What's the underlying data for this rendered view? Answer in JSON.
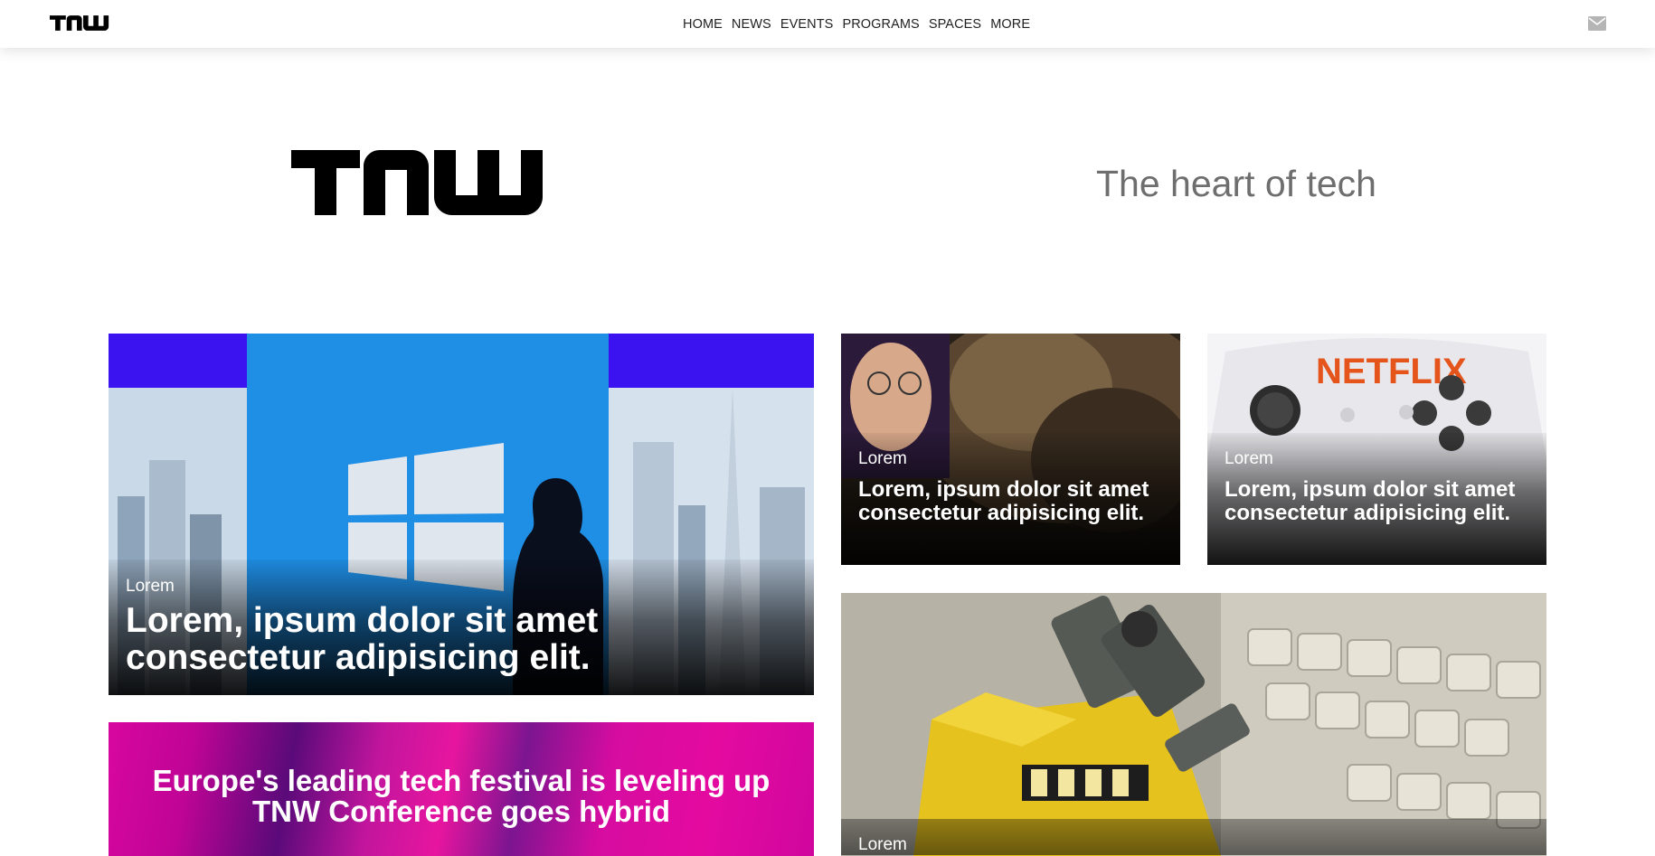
{
  "nav": {
    "logo_label": "TNW",
    "items": [
      "HOME",
      "NEWS",
      "EVENTS",
      "PROGRAMS",
      "SPACES",
      "MORE"
    ],
    "mail_icon": "envelope-icon"
  },
  "hero": {
    "logo_label": "TNW",
    "tagline": "The heart of tech"
  },
  "cards": [
    {
      "category": "Lorem",
      "title": "Lorem, ipsum dolor sit amet consectetur adipisicing elit.",
      "image": "windows-logo-keynote-photo"
    },
    {
      "category": "Lorem",
      "title": "Lorem, ipsum dolor sit amet consectetur adipisicing elit.",
      "image": "gabe-newell-creature-photo"
    },
    {
      "category": "Lorem",
      "title": "Lorem, ipsum dolor sit amet consectetur adipisicing elit.",
      "image": "netflix-controller-photo"
    },
    {
      "category": "Lorem",
      "image": "wall-e-keyboard-photo"
    }
  ],
  "promo": {
    "line1": "Europe's leading tech festival is leveling up",
    "line2": "TNW Conference goes hybrid"
  },
  "colors": {
    "tagline": "#6e6e6e",
    "promo_magenta": "#d7079f",
    "nav_text": "#222222"
  }
}
